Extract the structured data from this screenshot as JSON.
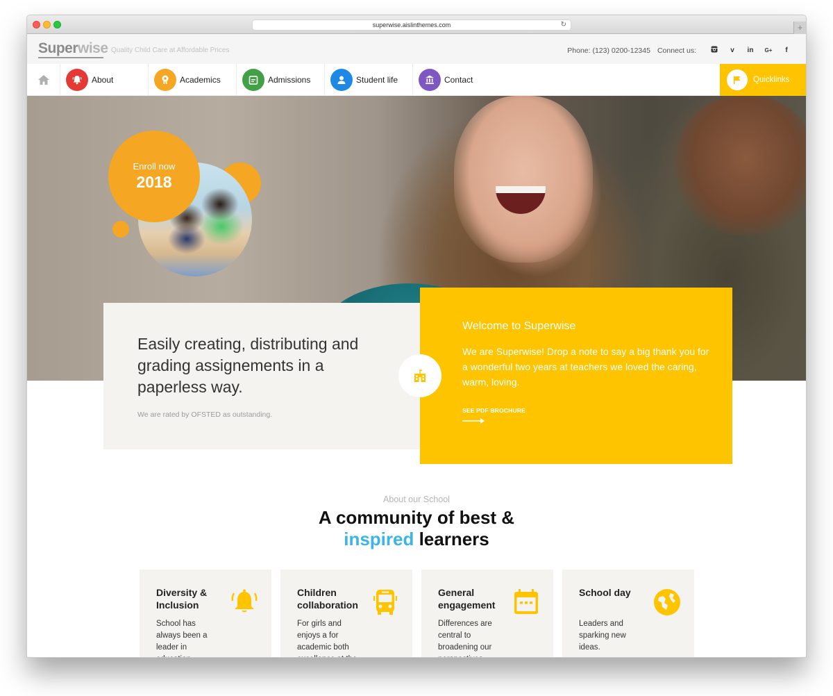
{
  "browser": {
    "url": "superwise.aislinthemes.com",
    "new_tab_label": "+"
  },
  "topbar": {
    "logo_part1": "Super",
    "logo_part2": "wise",
    "tagline": "Quality Child Care at Affordable Prices",
    "phone": "Phone: (123) 0200-12345",
    "connect_label": "Connect us:",
    "social": [
      {
        "name": "instagram",
        "glyph": "◙"
      },
      {
        "name": "vimeo",
        "glyph": "v"
      },
      {
        "name": "linkedin",
        "glyph": "in"
      },
      {
        "name": "google-plus",
        "glyph": "G+"
      },
      {
        "name": "facebook",
        "glyph": "f"
      }
    ]
  },
  "nav": {
    "items": [
      {
        "label": "About",
        "icon": "bell-icon",
        "color": "#e53935"
      },
      {
        "label": "Academics",
        "icon": "award-icon",
        "color": "#f5a623"
      },
      {
        "label": "Admissions",
        "icon": "calendar-icon",
        "color": "#43a047"
      },
      {
        "label": "Student life",
        "icon": "person-icon",
        "color": "#1e88e5"
      },
      {
        "label": "Contact",
        "icon": "bank-icon",
        "color": "#7e57c2"
      }
    ],
    "quicklinks_label": "Quicklinks",
    "quicklinks_color": "#fec400"
  },
  "hero": {
    "enroll_line1": "Enroll now",
    "enroll_year": "2018",
    "accent_color": "#f5a623"
  },
  "intro": {
    "headline": "Easily creating, distributing and grading assignements in a paperless way.",
    "rating_note": "We are rated by OFSTED as outstanding."
  },
  "welcome": {
    "title": "Welcome to Superwise",
    "body": "We are Superwise! Drop a note to say a big thank you for a wonderful two years at teachers we loved the caring, warm, loving.",
    "cta": "SEE PDF BROCHURE",
    "color": "#fec400"
  },
  "about": {
    "eyebrow": "About our School",
    "title_line1": "A community of best &",
    "title_accent": "inspired",
    "title_rest": " learners",
    "accent_color": "#3ab5e6"
  },
  "features": [
    {
      "title": "Diversity & Inclusion",
      "desc": "School has always been a leader in education",
      "icon": "bell-icon"
    },
    {
      "title": "Children collaboration",
      "desc": "For girls and enjoys a for academic both excellence at the",
      "icon": "bus-icon"
    },
    {
      "title": "General engagement",
      "desc": "Differences are central to broadening our perspectives",
      "icon": "calendar-icon"
    },
    {
      "title": "School day",
      "desc": "Leaders and sparking new ideas.",
      "icon": "globe-icon"
    }
  ]
}
